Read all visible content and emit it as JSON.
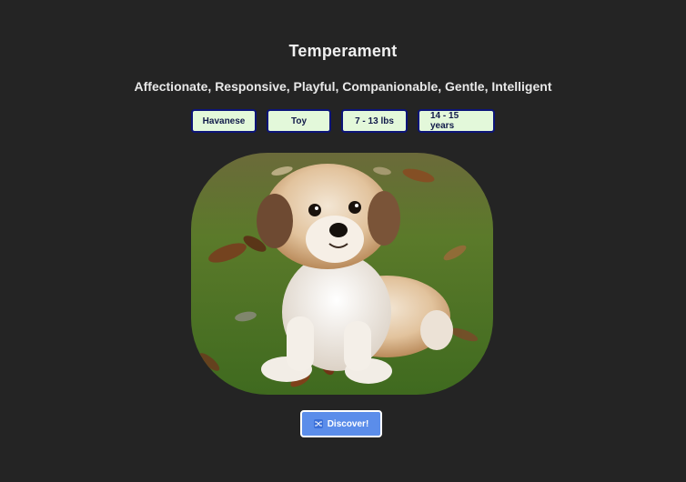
{
  "heading": "Temperament",
  "traits": "Affectionate, Responsive, Playful, Companionable, Gentle, Intelligent",
  "tags": {
    "breed": "Havanese",
    "group": "Toy",
    "weight": "7 - 13 lbs",
    "life_span": "14 - 15 years"
  },
  "discover_button": {
    "label": "Discover!",
    "icon": "shuffle-icon"
  },
  "colors": {
    "background": "#242424",
    "tag_fill": "#e3f8da",
    "tag_border": "#0c1478",
    "button_fill": "#5b8dea"
  }
}
